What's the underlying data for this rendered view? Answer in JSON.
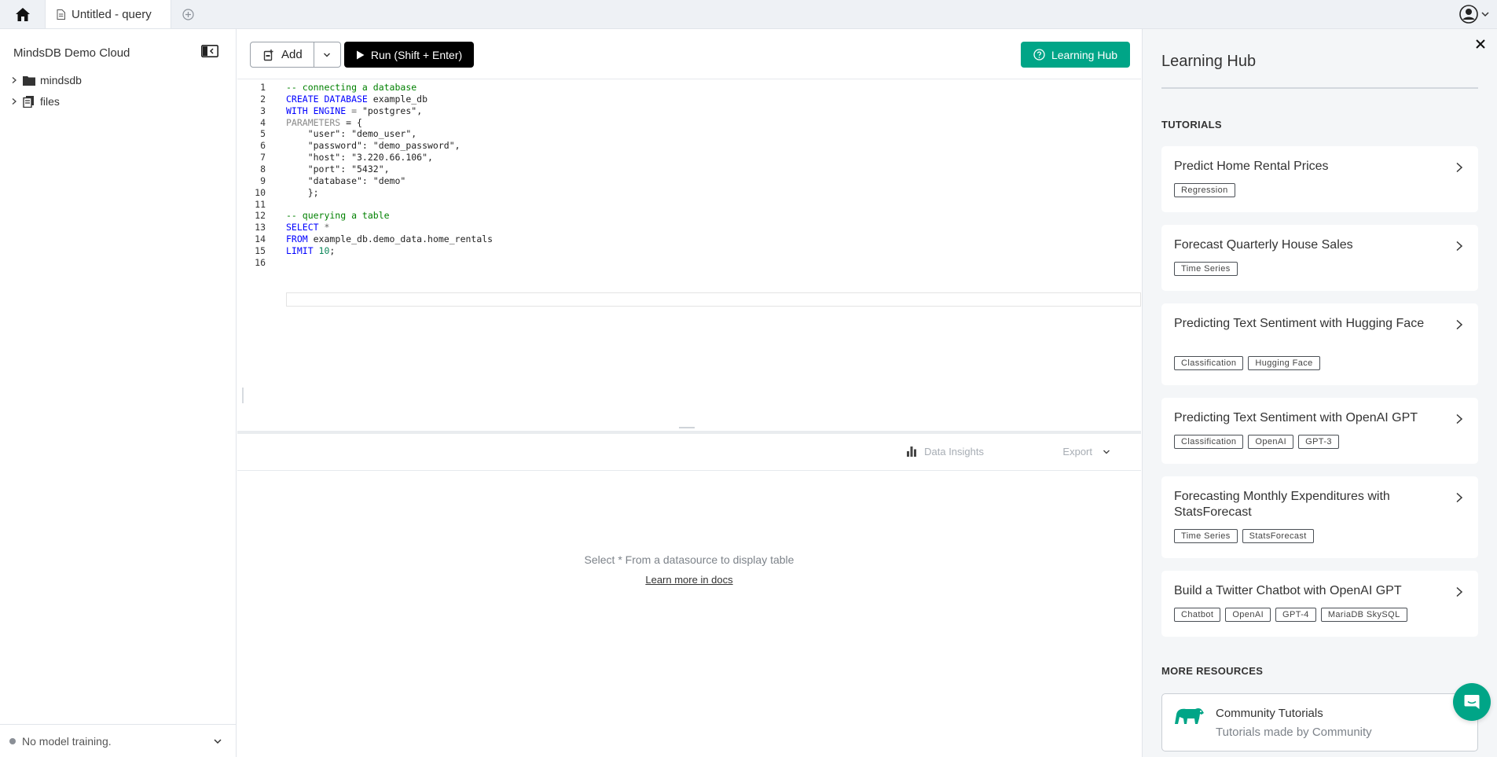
{
  "tabs": [
    {
      "label": "Untitled - query"
    }
  ],
  "sidebar": {
    "title": "MindsDB Demo Cloud",
    "items": [
      {
        "label": "mindsdb"
      },
      {
        "label": "files"
      }
    ],
    "status": "No model training."
  },
  "toolbar": {
    "add_label": "Add",
    "run_label": "Run (Shift + Enter)",
    "learning_hub_label": "Learning Hub"
  },
  "editor": {
    "line_numbers": [
      "1",
      "2",
      "3",
      "4",
      "5",
      "6",
      "7",
      "8",
      "9",
      "10",
      "11",
      "12",
      "13",
      "14",
      "15",
      "16"
    ],
    "lines": [
      [
        {
          "t": "-- connecting a database",
          "c": "comment"
        }
      ],
      [
        {
          "t": "CREATE DATABASE",
          "c": "kw"
        },
        {
          "t": " example_db",
          "c": "id"
        }
      ],
      [
        {
          "t": "WITH ENGINE",
          "c": "kw"
        },
        {
          "t": " = ",
          "c": "op"
        },
        {
          "t": "\"postgres\"",
          "c": "id"
        },
        {
          "t": ",",
          "c": "id"
        }
      ],
      [
        {
          "t": "PARAMETERS",
          "c": "param"
        },
        {
          "t": " = {",
          "c": "id"
        }
      ],
      [
        {
          "t": "    \"user\": \"demo_user\",",
          "c": "id"
        }
      ],
      [
        {
          "t": "    \"password\": \"demo_password\",",
          "c": "id"
        }
      ],
      [
        {
          "t": "    \"host\": \"3.220.66.106\",",
          "c": "id"
        }
      ],
      [
        {
          "t": "    \"port\": \"5432\",",
          "c": "id"
        }
      ],
      [
        {
          "t": "    \"database\": \"demo\"",
          "c": "id"
        }
      ],
      [
        {
          "t": "    };",
          "c": "id"
        }
      ],
      [],
      [
        {
          "t": "-- querying a table",
          "c": "comment"
        }
      ],
      [
        {
          "t": "SELECT",
          "c": "kw"
        },
        {
          "t": " *",
          "c": "op"
        }
      ],
      [
        {
          "t": "FROM",
          "c": "kw"
        },
        {
          "t": " example_db.demo_data.home_rentals",
          "c": "id"
        }
      ],
      [
        {
          "t": "LIMIT",
          "c": "kw"
        },
        {
          "t": " 10",
          "c": "num"
        },
        {
          "t": ";",
          "c": "id"
        }
      ],
      []
    ]
  },
  "results": {
    "insights_label": "Data Insights",
    "export_label": "Export",
    "empty_message": "Select * From a datasource to display table",
    "docs_link": "Learn more in docs"
  },
  "hub": {
    "title": "Learning Hub",
    "tutorials_label": "TUTORIALS",
    "tutorials": [
      {
        "title": "Predict Home Rental Prices",
        "tags": [
          "Regression"
        ]
      },
      {
        "title": "Forecast Quarterly House Sales",
        "tags": [
          "Time Series"
        ]
      },
      {
        "title": "Predicting Text Sentiment with Hugging Face",
        "tags": [
          "Classification",
          "Hugging Face"
        ]
      },
      {
        "title": "Predicting Text Sentiment with OpenAI GPT",
        "tags": [
          "Classification",
          "OpenAI",
          "GPT-3"
        ]
      },
      {
        "title": "Forecasting Monthly Expenditures with StatsForecast",
        "tags": [
          "Time Series",
          "StatsForecast"
        ]
      },
      {
        "title": "Build a Twitter Chatbot with OpenAI GPT",
        "tags": [
          "Chatbot",
          "OpenAI",
          "GPT-4",
          "MariaDB SkySQL"
        ]
      }
    ],
    "resources_label": "MORE RESOURCES",
    "resource": {
      "title": "Community Tutorials",
      "subtitle": "Tutorials made by Community"
    }
  },
  "colors": {
    "accent": "#00a587",
    "run_button": "#000000"
  }
}
